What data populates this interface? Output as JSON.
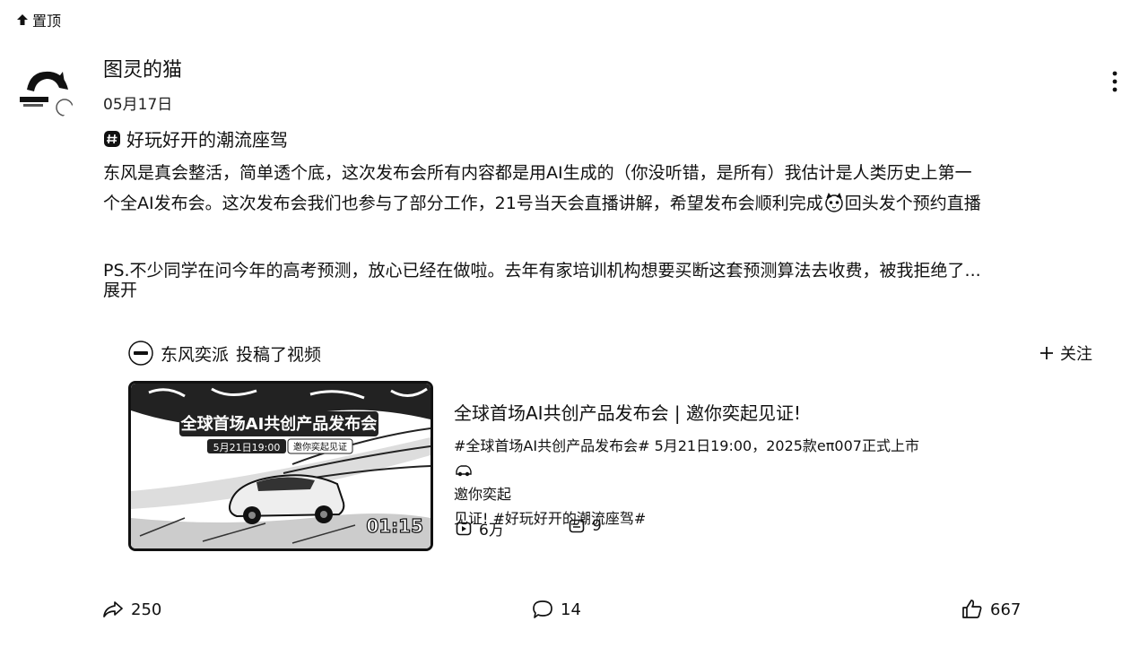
{
  "pin": {
    "label": "置顶"
  },
  "post": {
    "author": "图灵的猫",
    "date": "05月17日",
    "topic": "好玩好开的潮流座驾",
    "body_line1": "东风是真会整活，简单透个底，这次发布会所有内容都是用AI生成的（你没听错，是所有）我估计是人类历史上第一",
    "body_line2a": "个全AI发布会。这次发布会我们也参与了部分工作，21号当天会直播讲解，希望发布会顺利完成",
    "body_line2b": "回头发个预约直播",
    "body_line3": "PS.不少同学在问今年的高考预测，放心已经在做啦。去年有家培训机构想要买断这套预测算法去收费，被我拒绝了...",
    "expand_label": "展开"
  },
  "repost": {
    "account": "东风奕派",
    "action": "投稿了视频",
    "follow_label": "关注",
    "thumb_title": "全球首场AI共创产品发布会",
    "thumb_subtitle": "5月21日19:00",
    "thumb_tag": "邀你奕起见证",
    "duration": "01:15",
    "video_title": "全球首场AI共创产品发布会 | 邀你奕起见证!",
    "desc_line1a": "#全球首场AI共创产品发布会# 5月21日19:00，2025款eπ007正式上市 ",
    "desc_line1b": "邀你奕起",
    "desc_line2": "见证!   #好玩好开的潮流座驾#",
    "plays": "6万",
    "comments": "9"
  },
  "actions": {
    "share_count": "250",
    "comment_count": "14",
    "like_count": "667"
  },
  "icons": {
    "pin": "pin-up-arrow-icon",
    "more": "more-vertical-icon",
    "topic": "hashtag-icon",
    "follow": "plus-icon",
    "play": "play-icon",
    "danmaku": "danmaku-icon",
    "share": "share-icon",
    "comment": "comment-icon",
    "like": "thumbs-up-icon"
  }
}
